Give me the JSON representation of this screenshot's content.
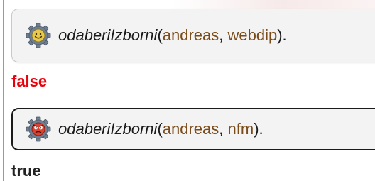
{
  "queries": [
    {
      "functor": "odaberiIzborni",
      "open_paren": "(",
      "arg1": "andreas",
      "separator": ", ",
      "arg2": "webdip",
      "close": ").",
      "icon": "gear-smiley-icon",
      "answer": "false",
      "answer_color": "#e8000b",
      "selected": false
    },
    {
      "functor": "odaberiIzborni",
      "open_paren": "(",
      "arg1": "andreas",
      "separator": ", ",
      "arg2": "nfm",
      "close": ").",
      "icon": "gear-angry-icon",
      "answer": "true",
      "answer_color": "#222222",
      "selected": true
    }
  ]
}
